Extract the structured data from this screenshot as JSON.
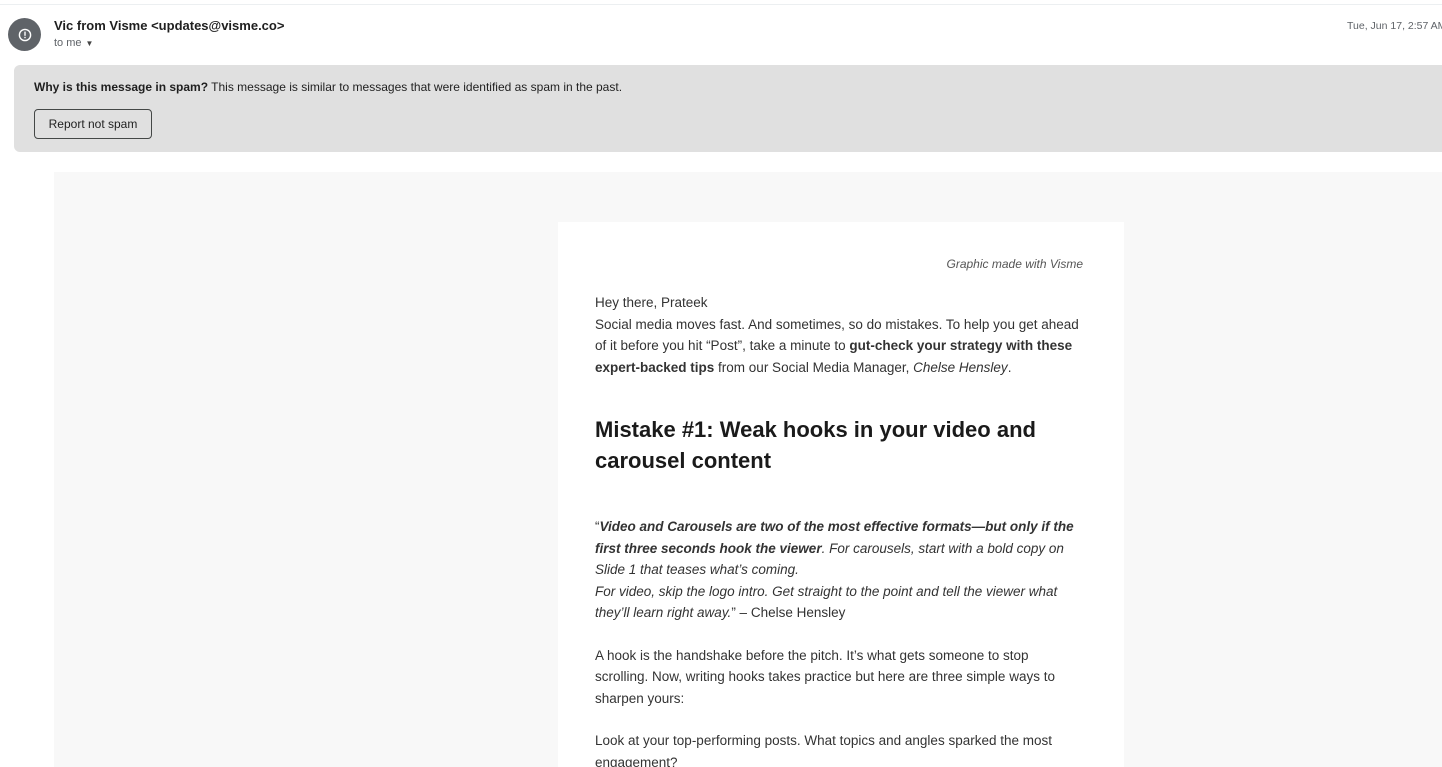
{
  "header": {
    "sender_name": "Vic from Visme",
    "sender_email": "<updates@visme.co>",
    "recipient": "to me",
    "date": "Tue, Jun 17, 2:57 AM ("
  },
  "spam_banner": {
    "question": "Why is this message in spam?",
    "explanation": " This message is similar to messages that were identified as spam in the past.",
    "report_button": "Report not spam"
  },
  "email": {
    "credit": "Graphic made with Visme",
    "greeting": "Hey there, Prateek",
    "intro_pre": "Social media moves fast. And sometimes, so do mistakes. To help you get ahead of it before you hit “Post”, take a minute to ",
    "intro_bold": "gut-check your strategy with these expert-backed tips",
    "intro_mid": " from our Social Media Manager, ",
    "intro_author": "Chelse Hensley",
    "intro_end": ".",
    "heading": "Mistake #1: Weak hooks in your video and carousel content",
    "quote_open": "“",
    "quote_bold": "Video and Carousels are two of the most effective formats—but only if the first three seconds hook the viewer",
    "quote_rest1": ".  For carousels, start with a bold copy on Slide 1 that teases what’s coming.",
    "quote_rest2": "For video, skip the logo intro. Get straight to the point and tell the viewer what they’ll learn right away.",
    "quote_attrib": "” – Chelse Hensley",
    "para1": "A hook is the handshake before the pitch. It’s what gets someone to stop scrolling. Now, writing hooks takes practice but here are three simple ways to sharpen yours:",
    "para2": "Look at your top-performing posts. What topics and angles sparked the most engagement?"
  }
}
